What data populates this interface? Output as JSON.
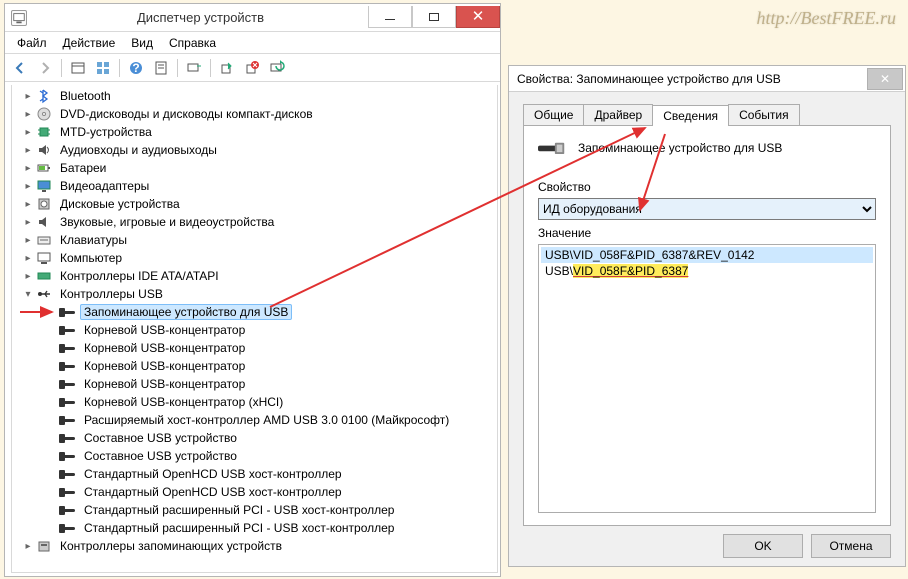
{
  "watermark": "http://BestFREE.ru",
  "device_manager": {
    "title": "Диспетчер устройств",
    "menu": {
      "file": "Файл",
      "action": "Действие",
      "view": "Вид",
      "help": "Справка"
    },
    "toolbar_icons": [
      "back",
      "forward",
      "show",
      "props",
      "help",
      "grid",
      "monitor",
      "add",
      "remove",
      "refresh"
    ],
    "tree": [
      {
        "label": "Bluetooth",
        "icon": "bluetooth"
      },
      {
        "label": "DVD-дисководы и дисководы компакт-дисков",
        "icon": "disc"
      },
      {
        "label": "MTD-устройства",
        "icon": "chip"
      },
      {
        "label": "Аудиовходы и аудиовыходы",
        "icon": "audio"
      },
      {
        "label": "Батареи",
        "icon": "battery"
      },
      {
        "label": "Видеоадаптеры",
        "icon": "display"
      },
      {
        "label": "Дисковые устройства",
        "icon": "hdd"
      },
      {
        "label": "Звуковые, игровые и видеоустройства",
        "icon": "sound"
      },
      {
        "label": "Клавиатуры",
        "icon": "keyboard"
      },
      {
        "label": "Компьютер",
        "icon": "computer"
      },
      {
        "label": "Контроллеры IDE ATA/ATAPI",
        "icon": "ide"
      },
      {
        "label": "Контроллеры USB",
        "icon": "usb",
        "expanded": true,
        "children": [
          {
            "label": "Запоминающее устройство для USB",
            "selected": true
          },
          {
            "label": "Корневой USB-концентратор"
          },
          {
            "label": "Корневой USB-концентратор"
          },
          {
            "label": "Корневой USB-концентратор"
          },
          {
            "label": "Корневой USB-концентратор"
          },
          {
            "label": "Корневой USB-концентратор (xHCI)"
          },
          {
            "label": "Расширяемый хост-контроллер AMD USB 3.0 0100 (Майкрософт)"
          },
          {
            "label": "Составное USB устройство"
          },
          {
            "label": "Составное USB устройство"
          },
          {
            "label": "Стандартный OpenHCD USB хост-контроллер"
          },
          {
            "label": "Стандартный OpenHCD USB хост-контроллер"
          },
          {
            "label": "Стандартный расширенный PCI - USB хост-контроллер"
          },
          {
            "label": "Стандартный расширенный PCI - USB хост-контроллер"
          }
        ]
      },
      {
        "label": "Контроллеры запоминающих устройств",
        "icon": "storage"
      }
    ]
  },
  "properties": {
    "title": "Свойства: Запоминающее устройство для USB",
    "tabs": {
      "general": "Общие",
      "driver": "Драйвер",
      "details": "Сведения",
      "events": "События"
    },
    "active_tab": "details",
    "device_name": "Запоминающее устройство для USB",
    "property_label": "Свойство",
    "property_selected": "ИД оборудования",
    "value_label": "Значение",
    "values": [
      {
        "prefix": "USB\\",
        "mid": "VID_058F&PID_6387",
        "suffix": "&REV_0142",
        "selected": true,
        "highlight": false
      },
      {
        "prefix": "USB\\",
        "mid": "VID_058F&PID_6387",
        "suffix": "",
        "selected": false,
        "highlight": true
      }
    ],
    "buttons": {
      "ok": "OK",
      "cancel": "Отмена"
    }
  }
}
